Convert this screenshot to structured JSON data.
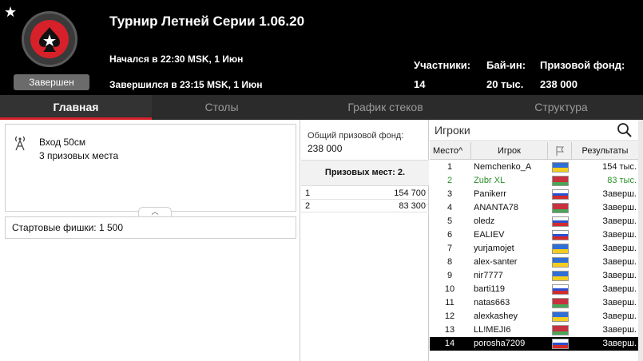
{
  "header": {
    "title": "Турнир Летней Серии 1.06.20",
    "started": "Начался в 22:30 MSK, 1 Июн",
    "finished": "Завершился в 23:15 MSK, 1 Июн",
    "status": "Завершен",
    "participants_label": "Участники:",
    "participants_value": "14",
    "buyin_label": "Бай-ин:",
    "buyin_value": "20 тыс.",
    "prizepool_label": "Призовой фонд:",
    "prizepool_value": "238 000"
  },
  "tabs": [
    {
      "label": "Главная",
      "active": true
    },
    {
      "label": "Столы"
    },
    {
      "label": "График стеков"
    },
    {
      "label": "Структура"
    }
  ],
  "info": {
    "entry": "Вход 50см",
    "prize_places": "3 призовых места",
    "starting_chips_label": "Стартовые фишки:",
    "starting_chips_value": "1 500"
  },
  "prizes": {
    "pool_label": "Общий призовой фонд:",
    "pool_value": "238 000",
    "places_header": "Призовых мест: 2.",
    "rows": [
      {
        "place": "1",
        "amount": "154 700"
      },
      {
        "place": "2",
        "amount": "83 300"
      }
    ]
  },
  "players": {
    "search_placeholder": "Игроки",
    "col_place": "Место",
    "col_player": "Игрок",
    "col_results": "Результаты",
    "rows": [
      {
        "place": "1",
        "name": "Nemchenko_A",
        "flag": "ua",
        "result": "154 тыс."
      },
      {
        "place": "2",
        "name": "Zubr XL",
        "flag": "by",
        "result": "83 тыс."
      },
      {
        "place": "3",
        "name": "Panikerr",
        "flag": "ru",
        "result": "Заверш."
      },
      {
        "place": "4",
        "name": "ANANTA78",
        "flag": "by",
        "result": "Заверш."
      },
      {
        "place": "5",
        "name": "oledz",
        "flag": "ru",
        "result": "Заверш."
      },
      {
        "place": "6",
        "name": "EALIEV",
        "flag": "ru",
        "result": "Заверш."
      },
      {
        "place": "7",
        "name": "yurjamojet",
        "flag": "ua",
        "result": "Заверш."
      },
      {
        "place": "8",
        "name": "alex-santer",
        "flag": "ua",
        "result": "Заверш."
      },
      {
        "place": "9",
        "name": "nir7777",
        "flag": "ua",
        "result": "Заверш."
      },
      {
        "place": "10",
        "name": "barti119",
        "flag": "ru",
        "result": "Заверш."
      },
      {
        "place": "11",
        "name": "natas663",
        "flag": "by",
        "result": "Заверш."
      },
      {
        "place": "12",
        "name": "alexkashey",
        "flag": "ua",
        "result": "Заверш."
      },
      {
        "place": "13",
        "name": "LL!MEJI6",
        "flag": "by",
        "result": "Заверш."
      },
      {
        "place": "14",
        "name": "porosha7209",
        "flag": "ru",
        "result": "Заверш."
      }
    ]
  },
  "colors": {
    "accent": "#d6212a",
    "header_bg": "#000000",
    "tab_bg": "#2b2b2b",
    "winner_green": "#2a8f2a"
  }
}
